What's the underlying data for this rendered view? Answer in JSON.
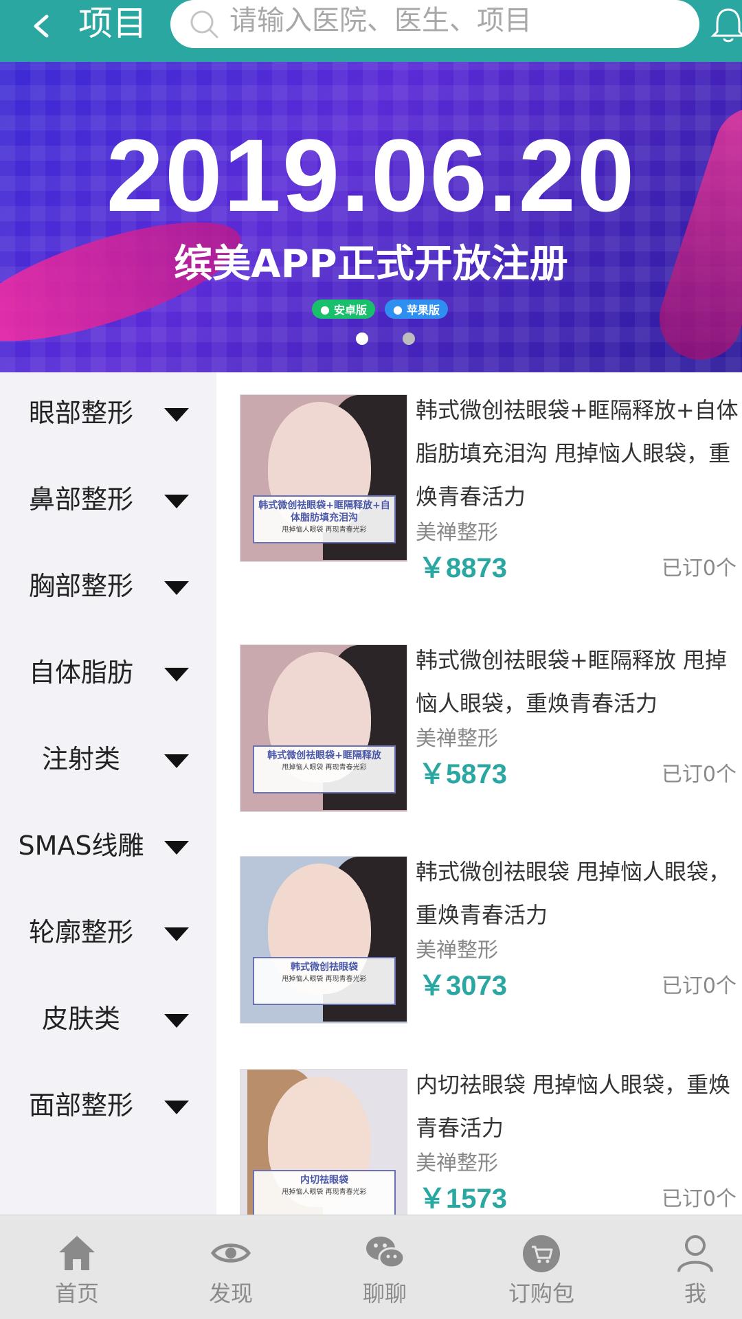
{
  "header": {
    "title": "项目",
    "search_placeholder": "请输入医院、医生、项目"
  },
  "banner": {
    "date": "2019.06.20",
    "subtitle": "缤美APP正式开放注册",
    "badge_android": "安卓版",
    "badge_ios": "苹果版",
    "slide_count": 2,
    "active_slide": 1
  },
  "categories": [
    {
      "label": "眼部整形"
    },
    {
      "label": "鼻部整形"
    },
    {
      "label": "胸部整形"
    },
    {
      "label": "自体脂肪"
    },
    {
      "label": "注射类"
    },
    {
      "label": "SMAS线雕"
    },
    {
      "label": "轮廓整形"
    },
    {
      "label": "皮肤类"
    },
    {
      "label": "面部整形"
    }
  ],
  "products": [
    {
      "name": "韩式微创祛眼袋+眶隔释放+自体脂肪填充泪沟 甩掉恼人眼袋，重焕青春活力",
      "hospital": "美禅整形",
      "price": "￥8873",
      "ordered": "已订0个",
      "thumb_title": "韩式微创祛眼袋+眶隔释放+自体脂肪填充泪沟",
      "thumb_sub": "甩掉恼人眼袋 再现青春光彩"
    },
    {
      "name": "韩式微创祛眼袋+眶隔释放 甩掉恼人眼袋，重焕青春活力",
      "hospital": "美禅整形",
      "price": "￥5873",
      "ordered": "已订0个",
      "thumb_title": "韩式微创祛眼袋+眶隔释放",
      "thumb_sub": "甩掉恼人眼袋 再现青春光彩"
    },
    {
      "name": "韩式微创祛眼袋 甩掉恼人眼袋，重焕青春活力",
      "hospital": "美禅整形",
      "price": "￥3073",
      "ordered": "已订0个",
      "thumb_title": "韩式微创祛眼袋",
      "thumb_sub": "甩掉恼人眼袋 再现青春光彩"
    },
    {
      "name": "内切祛眼袋 甩掉恼人眼袋，重焕青春活力",
      "hospital": "美禅整形",
      "price": "￥1573",
      "ordered": "已订0个",
      "thumb_title": "内切祛眼袋",
      "thumb_sub": "甩掉恼人眼袋 再现青春光彩"
    }
  ],
  "tabbar": [
    {
      "label": "首页",
      "icon": "home-icon"
    },
    {
      "label": "发现",
      "icon": "eye-icon"
    },
    {
      "label": "聊聊",
      "icon": "chat-icon"
    },
    {
      "label": "订购包",
      "icon": "cart-icon"
    },
    {
      "label": "我",
      "icon": "user-icon"
    }
  ],
  "colors": {
    "accent": "#2aa7a1",
    "sidebar_bg": "#f3f3f7",
    "tabbar_bg": "#e6e6e6"
  }
}
